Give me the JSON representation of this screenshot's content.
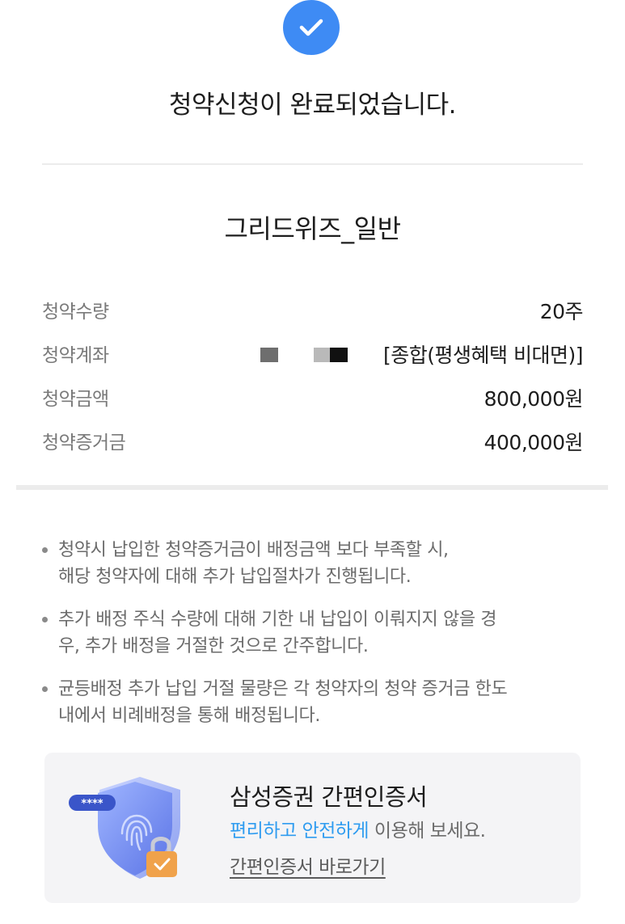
{
  "header": {
    "icon": "check-circle-icon",
    "title": "청약신청이 완료되었습니다."
  },
  "product": {
    "name": "그리드위즈_일반"
  },
  "details": {
    "quantity": {
      "label": "청약수량",
      "value": "20주"
    },
    "account": {
      "label": "청약계좌",
      "value": "[종합(평생혜택 비대면)]"
    },
    "amount": {
      "label": "청약금액",
      "value": "800,000원"
    },
    "deposit": {
      "label": "청약증거금",
      "value": "400,000원"
    }
  },
  "notices": [
    {
      "line1": "청약시 납입한 청약증거금이 배정금액 보다 부족할 시,",
      "line2": "해당 청약자에 대해 추가 납입절차가 진행됩니다."
    },
    {
      "line1": "추가 배정 주식 수량에 대해 기한 내 납입이 이뤄지지 않을 경",
      "line2": "우, 추가 배정을 거절한 것으로 간주합니다."
    },
    {
      "line1": "균등배정 추가 납입 거절 물량은 각 청약자의 청약 증거금 한도",
      "line2": "내에서 비례배정을 통해 배정됩니다."
    }
  ],
  "cert_card": {
    "title": "삼성증권 간편인증서",
    "highlight": "편리하고 안전하게",
    "desc_rest": " 이용해 보세요.",
    "link": "간편인증서 바로가기",
    "illustration_icon": "shield-fingerprint-lock-icon",
    "password_badge": "****"
  },
  "colors": {
    "accent": "#3e8bf4",
    "highlight": "#2f9cf0",
    "lock": "#f0a24b"
  }
}
